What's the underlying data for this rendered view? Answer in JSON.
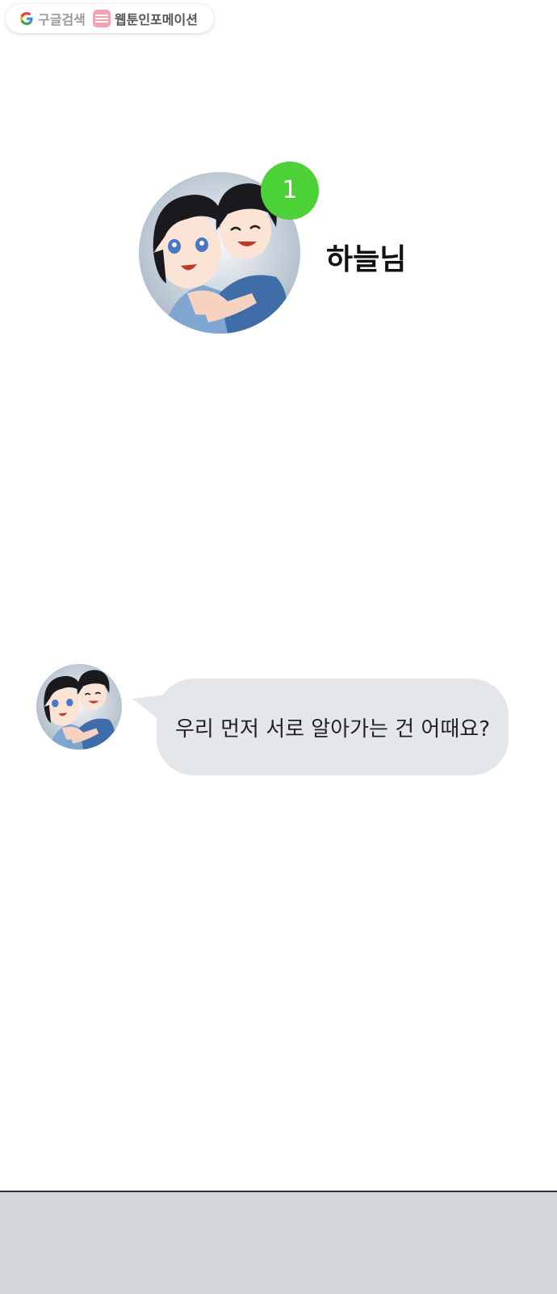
{
  "search": {
    "google_label": "구글검색",
    "brand_label": "웹툰인포메이션"
  },
  "profile": {
    "name": "하늘님",
    "unread_count": "1"
  },
  "chat": {
    "message": "우리 먼저 서로 알아가는 건 어때요?"
  },
  "icons": [
    "google-icon",
    "webtoon-brand-icon"
  ],
  "colors": {
    "badge": "#4cd137",
    "bubble": "#e4e7ea",
    "bottom_bar": "#d3d6d8"
  }
}
